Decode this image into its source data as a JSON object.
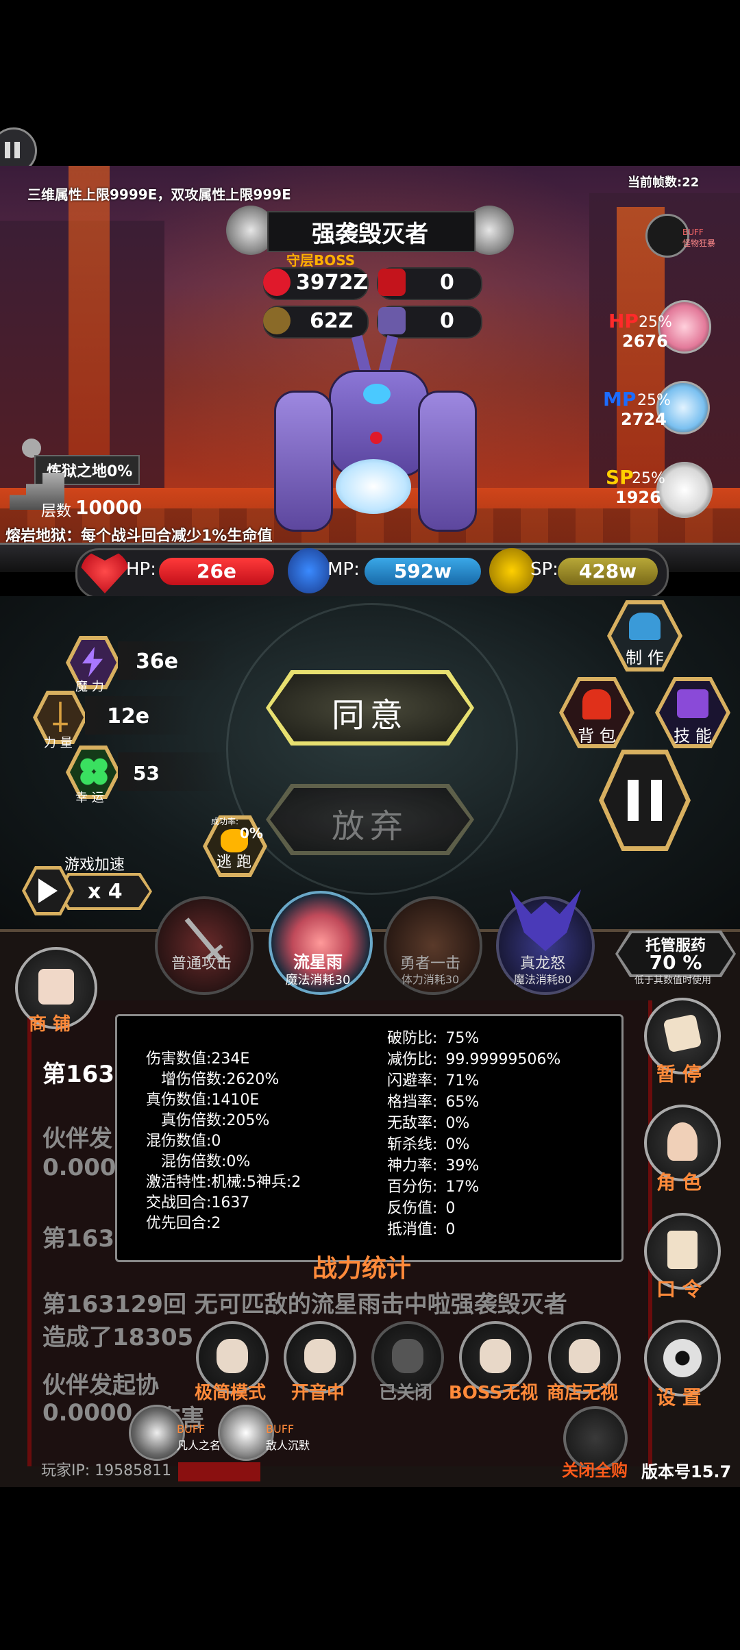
{
  "top_notice": "三维属性上限9999E，双攻属性上限999E",
  "wave_label": "当前帧数:22",
  "boss": {
    "name": "强袭毁灭者",
    "tag": "守层BOSS",
    "hp": "3972Z",
    "shield": "0",
    "attack": "62Z",
    "defense": "0"
  },
  "monster_buff": {
    "badge": "BUFF",
    "label": "怪物狂暴"
  },
  "potions": {
    "hp": {
      "label": "HP",
      "pct": "25%",
      "value": "2676"
    },
    "mp": {
      "label": "MP",
      "pct": "25%",
      "value": "2724"
    },
    "sp": {
      "label": "SP",
      "pct": "25%",
      "value": "1926"
    }
  },
  "stage": {
    "name": "炼狱之地0%",
    "floor_label": "层数",
    "floor_value": "10000"
  },
  "stage_effect": "熔岩地狱：每个战斗回合减少1%生命值",
  "player_bars": {
    "hp_label": "HP:",
    "hp_value": "26e",
    "mp_label": "MP:",
    "mp_value": "592w",
    "sp_label": "SP:",
    "sp_value": "428w"
  },
  "attributes": {
    "magic_label": "魔 力",
    "magic_value": "36e",
    "strength_label": "力 量",
    "strength_value": "12e",
    "luck_label": "幸 运",
    "luck_value": "53"
  },
  "actions": {
    "agree": "同意",
    "abandon": "放弃",
    "escape_rate_label": "成功率:",
    "escape_rate": "0%",
    "escape": "逃 跑",
    "speed_label": "游戏加速",
    "speed_value": "x 4"
  },
  "menu": {
    "craft": "制 作",
    "bag": "背 包",
    "skill": "技 能"
  },
  "skills": [
    {
      "name": "普通攻击",
      "cost": ""
    },
    {
      "name": "流星雨",
      "cost": "魔法消耗30"
    },
    {
      "name": "勇者一击",
      "cost": "体力消耗30"
    },
    {
      "name": "真龙怒",
      "cost": "魔法消耗80"
    }
  ],
  "auto_potion": {
    "title": "托管服药",
    "pct": "70 %",
    "note": "低于其数值时使用"
  },
  "shop": "商 铺",
  "side_buttons": {
    "pause": "暂 停",
    "role": "角 色",
    "code": "口 令",
    "settings": "设 置"
  },
  "log": {
    "line1": "第163",
    "line2a": "伙伴发",
    "line2b": "0.000",
    "line3": "第163",
    "line4": "第163129回 无可匹敌的流星雨击中啦强袭毁灭者",
    "line5": "造成了18305",
    "line6": "伙伴发起协",
    "line7": "0.0000",
    "line7b": "伤害"
  },
  "stats_panel": {
    "title": "战力统计",
    "left": [
      {
        "k": "伤害数值:",
        "v": "234E",
        "indent": false
      },
      {
        "k": "增伤倍数:",
        "v": "2620%",
        "indent": true
      },
      {
        "k": "真伤数值:",
        "v": "1410E",
        "indent": false
      },
      {
        "k": "真伤倍数:",
        "v": "205%",
        "indent": true
      },
      {
        "k": "混伤数值:",
        "v": "0",
        "indent": false
      },
      {
        "k": "混伤倍数:",
        "v": "0%",
        "indent": true
      },
      {
        "k": "激活特性:",
        "v": "机械:5神兵:2",
        "indent": false
      },
      {
        "k": "交战回合:",
        "v": "1637",
        "indent": false
      },
      {
        "k": "优先回合:",
        "v": "2",
        "indent": false
      }
    ],
    "right": [
      {
        "k": "破防比:",
        "v": "75%"
      },
      {
        "k": "减伤比:",
        "v": "99.99999506%"
      },
      {
        "k": "闪避率:",
        "v": "71%"
      },
      {
        "k": "格挡率:",
        "v": "65%"
      },
      {
        "k": "无敌率:",
        "v": "0%"
      },
      {
        "k": "斩杀线:",
        "v": "0%"
      },
      {
        "k": "神力率:",
        "v": "39%"
      },
      {
        "k": "百分伤:",
        "v": "17%"
      },
      {
        "k": "反伤值:",
        "v": "0"
      },
      {
        "k": "抵消值:",
        "v": "0"
      }
    ]
  },
  "toolbar": [
    {
      "label": "极简模式",
      "color": "#ff8a3a"
    },
    {
      "label": "开音中",
      "color": "#ff8a3a"
    },
    {
      "label": "已关闭",
      "color": "#8a8a8a"
    },
    {
      "label": "BOSS无视",
      "color": "#ff8a3a"
    },
    {
      "label": "商店无视",
      "color": "#ff8a3a"
    }
  ],
  "buffs": [
    {
      "badge": "BUFF",
      "label": "凡人之名"
    },
    {
      "badge": "BUFF",
      "label": "敌人沉默"
    }
  ],
  "close_purchase": "关闭全购",
  "version": "版本号15.7",
  "player_ip": "玩家IP: 19585811"
}
